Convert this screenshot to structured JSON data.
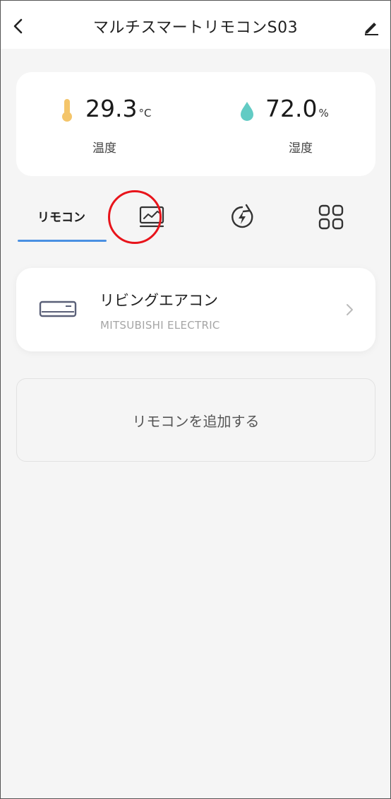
{
  "header": {
    "title": "マルチスマートリモコンS03"
  },
  "sensors": {
    "temperature": {
      "value": "29.3",
      "unit": "°C",
      "label": "温度"
    },
    "humidity": {
      "value": "72.0",
      "unit": "%",
      "label": "湿度"
    }
  },
  "tabs": {
    "remote_label": "リモコン",
    "items": [
      {
        "icon": "remote-tab"
      },
      {
        "icon": "chart-monitor-icon"
      },
      {
        "icon": "energy-icon"
      },
      {
        "icon": "grid-icon"
      }
    ],
    "active_index": 0
  },
  "devices": [
    {
      "name": "リビングエアコン",
      "brand": "MITSUBISHI ELECTRIC",
      "icon": "air-conditioner-icon"
    }
  ],
  "add_remote": {
    "label": "リモコンを追加する"
  },
  "colors": {
    "accent": "#4a90e2",
    "highlight": "#e8141b",
    "temperature_icon": "#f4c56a",
    "humidity_icon": "#62cbc4"
  }
}
